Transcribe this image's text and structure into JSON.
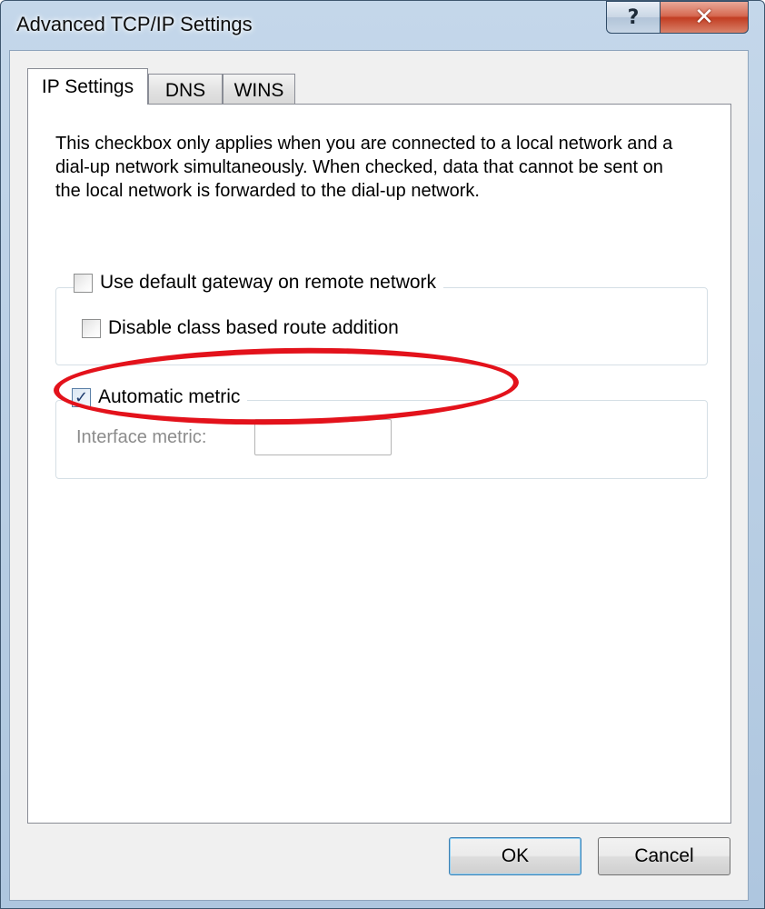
{
  "window": {
    "title": "Advanced TCP/IP Settings",
    "help_glyph": "?",
    "close_glyph": "✕"
  },
  "tabs": [
    {
      "label": "IP Settings",
      "selected": true
    },
    {
      "label": "DNS",
      "selected": false
    },
    {
      "label": "WINS",
      "selected": false
    }
  ],
  "panel": {
    "description": "This checkbox only applies when you are connected to a local network and a dial-up network simultaneously.  When checked, data that cannot be sent on the local network is forwarded to the dial-up network."
  },
  "options": {
    "use_default_gateway": {
      "label": "Use default gateway on remote network",
      "checked": false
    },
    "disable_class_route": {
      "label": "Disable class based route addition",
      "checked": false
    },
    "automatic_metric": {
      "label": "Automatic metric",
      "checked": true,
      "check_glyph": "✓"
    },
    "interface_metric": {
      "label": "Interface metric:",
      "value": "",
      "enabled": false
    }
  },
  "annotation": {
    "highlight_color": "#e3121b"
  },
  "buttons": {
    "ok_label": "OK",
    "cancel_label": "Cancel"
  }
}
